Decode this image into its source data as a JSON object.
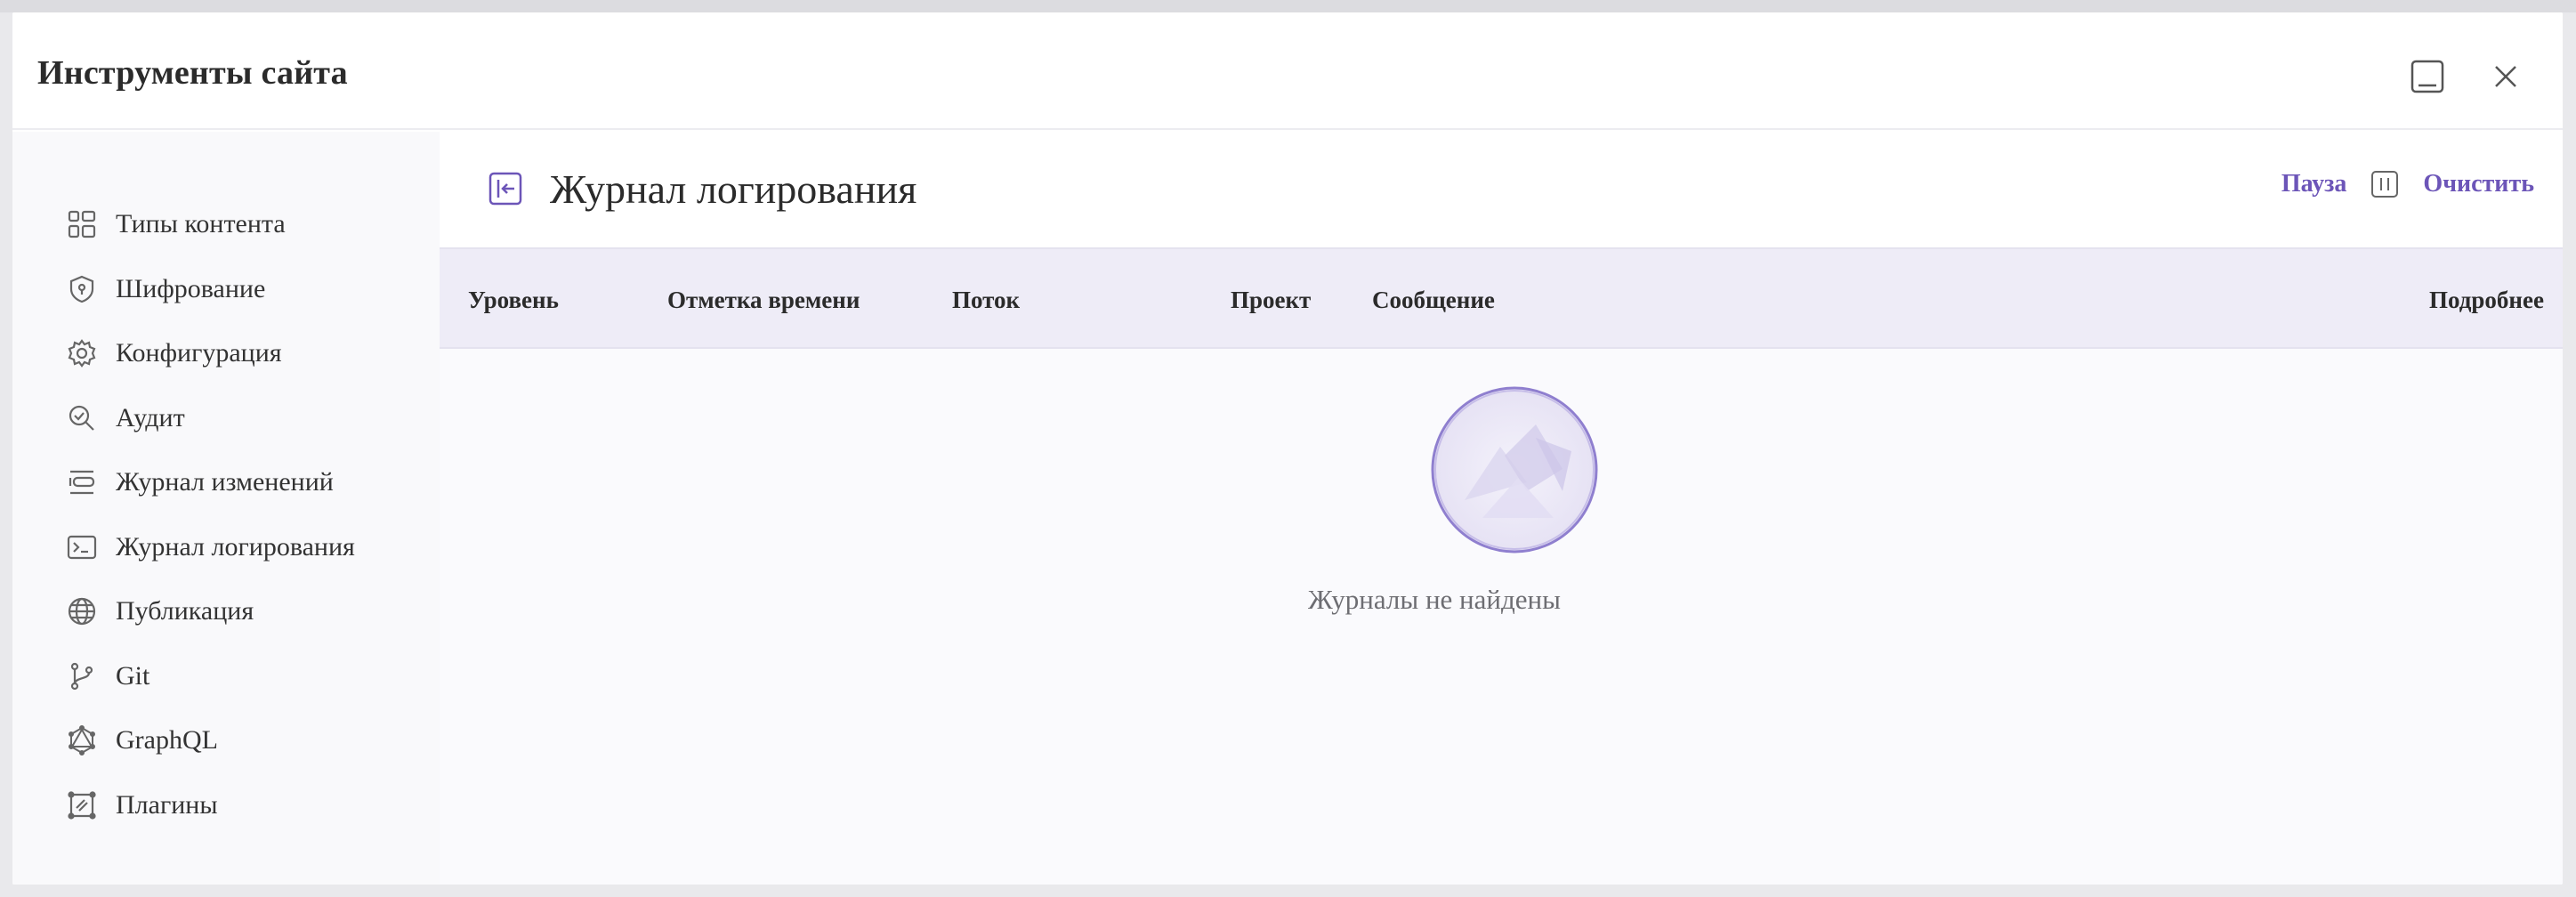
{
  "dialog": {
    "title": "Инструменты сайта",
    "minimize_icon": "minimize-icon",
    "close_icon": "close-icon"
  },
  "sidebar": {
    "items": [
      {
        "label": "Типы контента",
        "icon": "content-types-icon"
      },
      {
        "label": "Шифрование",
        "icon": "shield-icon"
      },
      {
        "label": "Конфигурация",
        "icon": "gear-icon"
      },
      {
        "label": "Аудит",
        "icon": "audit-search-icon"
      },
      {
        "label": "Журнал изменений",
        "icon": "changelog-icon"
      },
      {
        "label": "Журнал логирования",
        "icon": "terminal-icon"
      },
      {
        "label": "Публикация",
        "icon": "globe-icon"
      },
      {
        "label": "Git",
        "icon": "git-branch-icon"
      },
      {
        "label": "GraphQL",
        "icon": "graphql-icon"
      },
      {
        "label": "Плагины",
        "icon": "plugin-icon"
      }
    ]
  },
  "main": {
    "title": "Журнал логирования",
    "actions": {
      "pause_label": "Пауза",
      "clear_label": "Очистить"
    },
    "table": {
      "columns": [
        "Уровень",
        "Отметка времени",
        "Поток",
        "Проект",
        "Сообщение",
        "Подробнее"
      ],
      "rows": []
    },
    "empty_text": "Журналы не найдены"
  },
  "colors": {
    "accent": "#6c55b8",
    "header_bg": "#eeecf7",
    "sidebar_bg": "#f9f9fb"
  }
}
